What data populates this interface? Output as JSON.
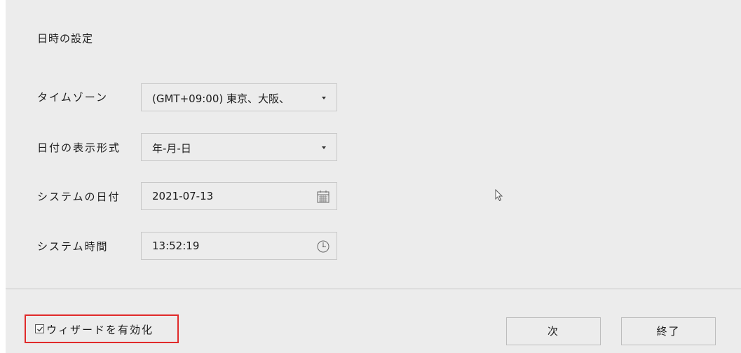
{
  "section": {
    "title": "日時の設定"
  },
  "form": {
    "timezone": {
      "label": "タイムゾーン",
      "value": "(GMT+09:00) 東京、大阪、"
    },
    "date_format": {
      "label": "日付の表示形式",
      "value": "年-月-日"
    },
    "system_date": {
      "label": "システムの日付",
      "value": "2021-07-13",
      "icon": "calendar-icon"
    },
    "system_time": {
      "label": "システム時間",
      "value": "13:52:19",
      "icon": "clock-icon"
    }
  },
  "footer": {
    "wizard_checkbox": {
      "label": "ウィザードを有効化",
      "checked": true
    },
    "next_label": "次",
    "finish_label": "終了"
  },
  "colors": {
    "background": "#ececec",
    "highlight": "#e02a2a"
  }
}
